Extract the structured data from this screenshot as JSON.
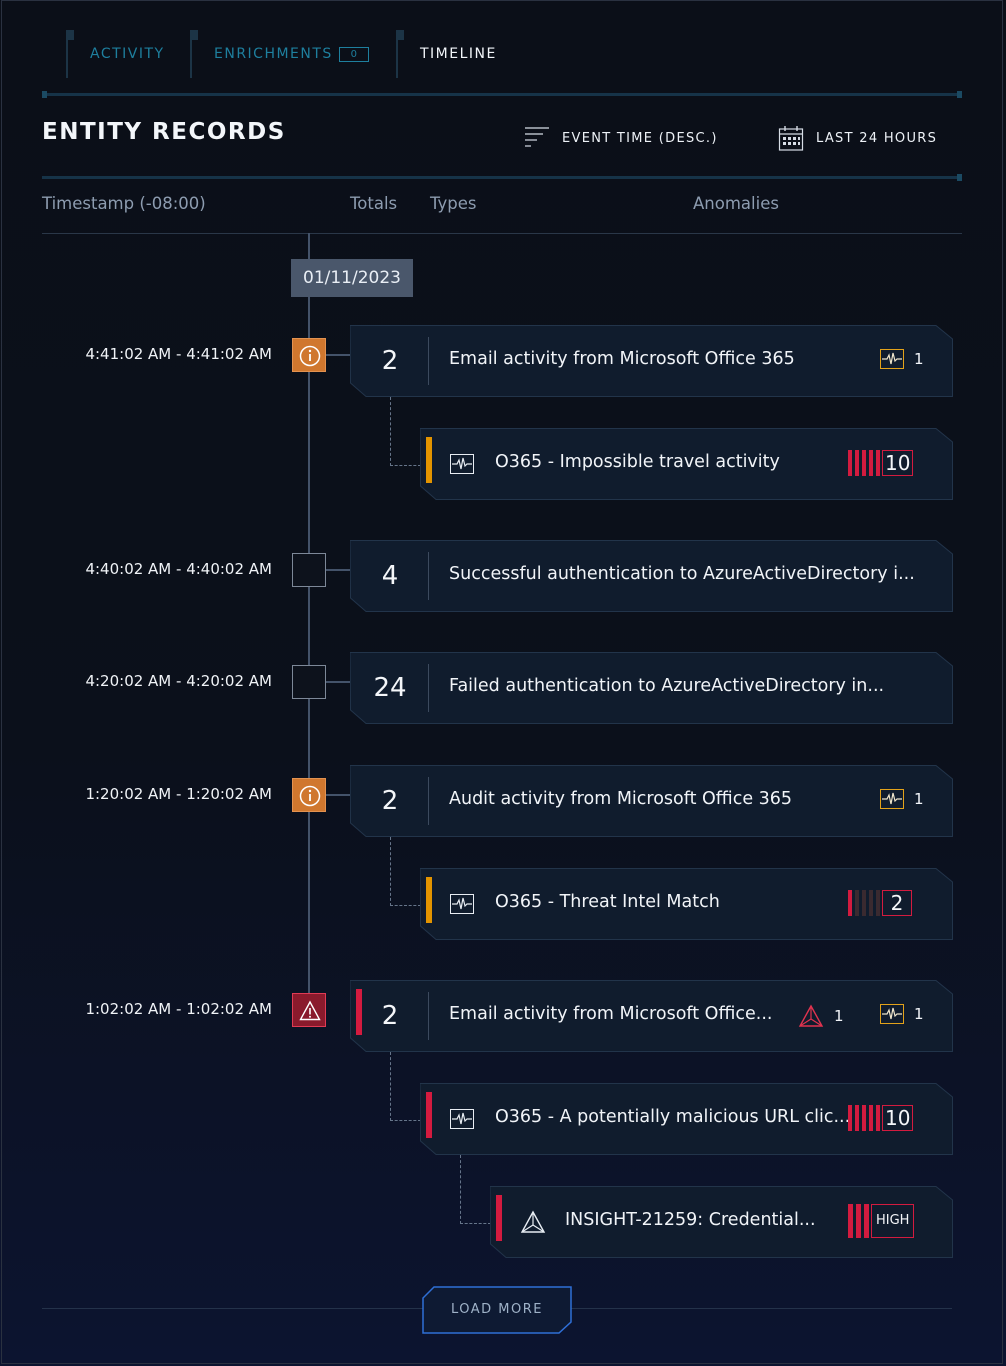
{
  "tabs": [
    {
      "label": "ACTIVITY",
      "active": false
    },
    {
      "label": "ENRICHMENTS",
      "badge": "0",
      "active": false
    },
    {
      "label": "TIMELINE",
      "active": true
    }
  ],
  "header": {
    "title": "ENTITY RECORDS",
    "sort_label": "EVENT TIME (DESC.)",
    "range_label": "LAST 24 HOURS"
  },
  "columns": {
    "timestamp": "Timestamp (-08:00)",
    "totals": "Totals",
    "types": "Types",
    "anomalies": "Anomalies"
  },
  "date_marker": "01/11/2023",
  "records": [
    {
      "time": "4:41:02 AM - 4:41:02 AM",
      "node": "info",
      "total": "2",
      "text": "Email activity from Microsoft Office 365",
      "pulse_count": "1",
      "children": [
        {
          "icon": "pulse-icon",
          "text": "O365 - Impossible travel activity",
          "severity_level": 5,
          "severity": "10",
          "accent": "orange"
        }
      ]
    },
    {
      "time": "4:40:02 AM - 4:40:02 AM",
      "node": "empty",
      "total": "4",
      "text": "Successful authentication to AzureActiveDirectory i..."
    },
    {
      "time": "4:20:02 AM - 4:20:02 AM",
      "node": "empty",
      "total": "24",
      "text": "Failed authentication to AzureActiveDirectory in..."
    },
    {
      "time": "1:20:02 AM - 1:20:02 AM",
      "node": "info",
      "total": "2",
      "text": "Audit activity from Microsoft Office 365",
      "pulse_count": "1",
      "children": [
        {
          "icon": "pulse-icon",
          "text": "O365 - Threat Intel Match",
          "severity_level": 1,
          "severity": "2",
          "accent": "orange"
        }
      ]
    },
    {
      "time": "1:02:02 AM - 1:02:02 AM",
      "node": "alert",
      "total": "2",
      "text": "Email activity from Microsoft Office...",
      "insight_count": "1",
      "pulse_count": "1",
      "children": [
        {
          "icon": "pulse-icon",
          "text": "O365 - A potentially malicious URL clic...",
          "severity_level": 5,
          "severity": "10",
          "accent": "red"
        },
        {
          "icon": "insight-icon",
          "text": "INSIGHT-21259: Credential...",
          "severity_level": 3,
          "severity": "HIGH",
          "accent": "red"
        }
      ]
    }
  ],
  "load_more": "LOAD MORE",
  "colors": {
    "accent_blue": "#1e7f9e",
    "info_orange": "#d0772e",
    "alert_red": "#d31b3f",
    "anomaly_yellow": "#e3a21a"
  }
}
